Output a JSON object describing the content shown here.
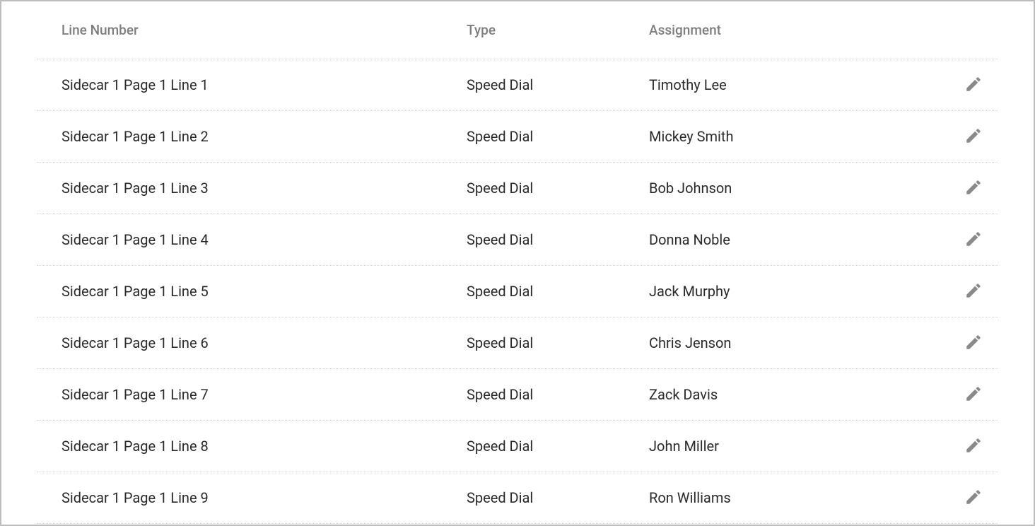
{
  "columns": {
    "line_number": "Line Number",
    "type": "Type",
    "assignment": "Assignment"
  },
  "rows": [
    {
      "line_number": "Sidecar 1 Page 1 Line 1",
      "type": "Speed Dial",
      "assignment": "Timothy Lee"
    },
    {
      "line_number": "Sidecar 1 Page 1 Line 2",
      "type": "Speed Dial",
      "assignment": "Mickey Smith"
    },
    {
      "line_number": "Sidecar 1 Page 1 Line 3",
      "type": "Speed Dial",
      "assignment": "Bob Johnson"
    },
    {
      "line_number": "Sidecar 1 Page 1 Line 4",
      "type": "Speed Dial",
      "assignment": "Donna Noble"
    },
    {
      "line_number": "Sidecar 1 Page 1 Line 5",
      "type": "Speed Dial",
      "assignment": "Jack Murphy"
    },
    {
      "line_number": "Sidecar 1 Page 1 Line 6",
      "type": "Speed Dial",
      "assignment": "Chris Jenson"
    },
    {
      "line_number": "Sidecar 1 Page 1 Line 7",
      "type": "Speed Dial",
      "assignment": "Zack Davis"
    },
    {
      "line_number": "Sidecar 1 Page 1 Line 8",
      "type": "Speed Dial",
      "assignment": "John Miller"
    },
    {
      "line_number": "Sidecar 1 Page 1 Line 9",
      "type": "Speed Dial",
      "assignment": "Ron Williams"
    }
  ]
}
